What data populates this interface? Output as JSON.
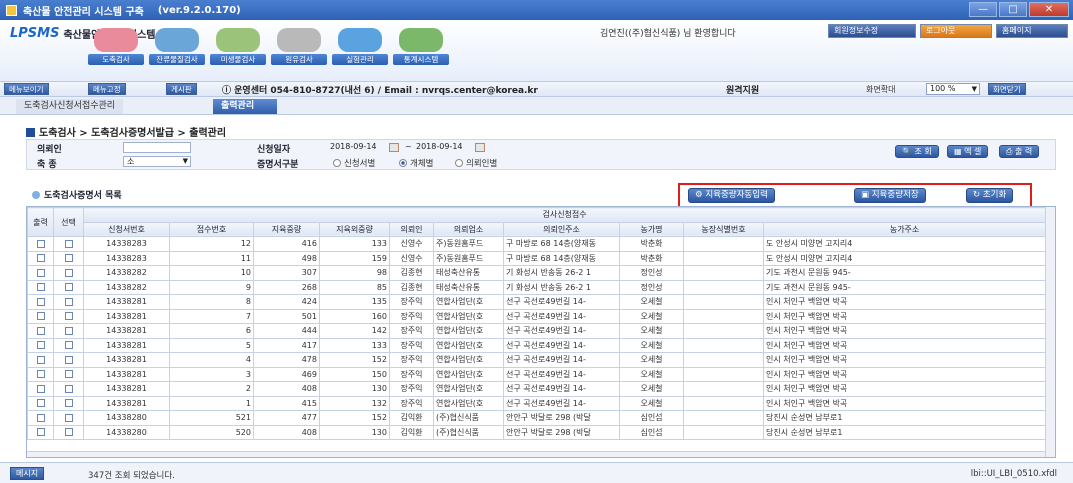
{
  "window": {
    "title": "축산물 안전관리 시스템 구축",
    "version": "(ver.9.2.0.170)"
  },
  "header": {
    "logo_mark": "LPSMS",
    "logo_text": "축산물안전관리시스템",
    "welcome": "김연진((주)협신식품) 님 환영합니다",
    "info_btn": "회원정보수정",
    "logout_btn": "로그아웃",
    "home_btn": "홈페이지",
    "menus": [
      {
        "label": "도축검사",
        "color": "#e98b9a"
      },
      {
        "label": "잔류물질검사",
        "color": "#6aa6d8"
      },
      {
        "label": "미생물검사",
        "color": "#9bc47a"
      },
      {
        "label": "원유검사",
        "color": "#b9b9b9"
      },
      {
        "label": "실험관리",
        "color": "#5aa3e0"
      },
      {
        "label": "통계시스템",
        "color": "#7bb86a"
      }
    ]
  },
  "toolbar": {
    "menu_show": "메뉴보이기",
    "menu_fix": "메뉴고정",
    "board": "게시판",
    "center_info": "ⓘ 운영센터 054-810-8727(내선 6) / Email : nvrqs.center@korea.kr",
    "remote": "원격지원",
    "zoom_label": "화면확대",
    "zoom_value": "100 %",
    "close_screen": "화면닫기"
  },
  "tabs": [
    {
      "label": "도축검사신청서접수관리",
      "active": false
    },
    {
      "label": "출력관리",
      "active": true
    }
  ],
  "breadcrumb": "도축검사 > 도축검사증명서발급 > 출력관리",
  "search": {
    "requester_label": "의뢰인",
    "requester_value": "",
    "species_label": "축 종",
    "species_value": "소",
    "date_label": "신청일자",
    "date_from": "2018-09-14",
    "date_sep": "~",
    "date_to": "2018-09-14",
    "cert_type_label": "증명서구분",
    "radio_options": [
      {
        "label": "신청서별",
        "checked": false
      },
      {
        "label": "개체별",
        "checked": true
      },
      {
        "label": "의뢰인별",
        "checked": false
      }
    ],
    "btn_search": "조 회",
    "btn_excel": "엑 셀",
    "btn_print": "출 력"
  },
  "list": {
    "title": "도축검사증명서 목록",
    "btn_auto_input": "지육중량자동입력",
    "btn_save": "지육중량저장",
    "btn_reset": "초기화",
    "group_header": "검사신청접수",
    "columns": [
      "출력",
      "선택",
      "신청서번호",
      "접수번호",
      "지육중량",
      "지육외중량",
      "의뢰인",
      "의뢰업소",
      "의뢰인주소",
      "농가명",
      "농장식별번호",
      "농가주소"
    ],
    "rows": [
      [
        "14338283",
        "12",
        "416",
        "133",
        "신영수",
        "주)동원홈푸드",
        "구 마방로 68 14층(양재동",
        "박춘화",
        "",
        "도 안성시 미양면 고지리4"
      ],
      [
        "14338283",
        "11",
        "498",
        "159",
        "신영수",
        "주)동원홈푸드",
        "구 마방로 68 14층(양재동",
        "박춘화",
        "",
        "도 안성시 미양면 고지리4"
      ],
      [
        "14338282",
        "10",
        "307",
        "98",
        "김종현",
        "태성축산유통",
        "기 화성시 반송동 26-2 1",
        "정인성",
        "",
        "기도 과천시 문원동 945-"
      ],
      [
        "14338282",
        "9",
        "268",
        "85",
        "김종현",
        "태성축산유통",
        "기 화성시 반송동 26-2 1",
        "정인성",
        "",
        "기도 과천시 문원동 945-"
      ],
      [
        "14338281",
        "8",
        "424",
        "135",
        "장주익",
        "연합사업단(호",
        "선구 곡선로49번길 14-",
        "오세철",
        "",
        "인시 처인구 백암면 박곡"
      ],
      [
        "14338281",
        "7",
        "501",
        "160",
        "장주익",
        "연합사업단(호",
        "선구 곡선로49번길 14-",
        "오세철",
        "",
        "인시 처인구 백암면 박곡"
      ],
      [
        "14338281",
        "6",
        "444",
        "142",
        "장주익",
        "연합사업단(호",
        "선구 곡선로49번길 14-",
        "오세철",
        "",
        "인시 처인구 백암면 박곡"
      ],
      [
        "14338281",
        "5",
        "417",
        "133",
        "장주익",
        "연합사업단(호",
        "선구 곡선로49번길 14-",
        "오세철",
        "",
        "인시 처인구 백암면 박곡"
      ],
      [
        "14338281",
        "4",
        "478",
        "152",
        "장주익",
        "연합사업단(호",
        "선구 곡선로49번길 14-",
        "오세철",
        "",
        "인시 처인구 백암면 박곡"
      ],
      [
        "14338281",
        "3",
        "469",
        "150",
        "장주익",
        "연합사업단(호",
        "선구 곡선로49번길 14-",
        "오세철",
        "",
        "인시 처인구 백암면 박곡"
      ],
      [
        "14338281",
        "2",
        "408",
        "130",
        "장주익",
        "연합사업단(호",
        "선구 곡선로49번길 14-",
        "오세철",
        "",
        "인시 처인구 백암면 박곡"
      ],
      [
        "14338281",
        "1",
        "415",
        "132",
        "장주익",
        "연합사업단(호",
        "선구 곡선로49번길 14-",
        "오세철",
        "",
        "인시 처인구 백암면 박곡"
      ],
      [
        "14338280",
        "521",
        "477",
        "152",
        "김익환",
        "(주)협신식품",
        "안안구 박달로 298 (박달",
        "심인섭",
        "",
        "당진시 순성면 남부로1"
      ],
      [
        "14338280",
        "520",
        "408",
        "130",
        "김익환",
        "(주)협신식품",
        "안안구 박달로 298 (박달",
        "심인섭",
        "",
        "당진시 순성면 남부로1"
      ]
    ]
  },
  "status": {
    "msg_btn": "메시지",
    "message": "347건 조회 되었습니다.",
    "form_id": "lbi::UI_LBI_0510.xfdl"
  }
}
